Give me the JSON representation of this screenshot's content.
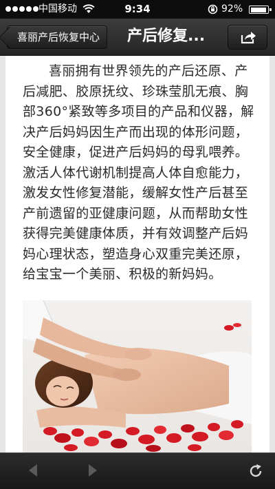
{
  "status_bar": {
    "carrier": "中国移动",
    "time": "9:34",
    "battery_percent": "92%",
    "battery_level": 0.92,
    "signal_bars": 5
  },
  "nav": {
    "back_label": "喜丽产后恢复中心",
    "title": "产后修复...",
    "share_icon": "share-icon"
  },
  "article": {
    "paragraph": "喜丽拥有世界领先的产后还原、产后减肥、胶原抚纹、珍珠莹肌无痕、胸部360°紧致等多项目的产品和仪器，解决产后妈妈因生产而出现的体形问题，安全健康，促进产后妈妈的母乳喂养。激活人体代谢机制提高人体自愈能力，激发女性修复潜能，缓解女性产后甚至产前遗留的亚健康问题，从而帮助女性获得完美健康体质，并有效调整产后妈妈心理状态，塑造身心双重完美还原，给宝宝一个美丽、积极的新妈妈。"
  },
  "toolbar": {
    "back_icon": "arrow-left-icon",
    "forward_icon": "arrow-right-icon",
    "reload_icon": "reload-icon"
  },
  "colors": {
    "bar_dark": "#1a1a1a",
    "petal_red": "#d41a24",
    "text": "#2a2a2a"
  }
}
